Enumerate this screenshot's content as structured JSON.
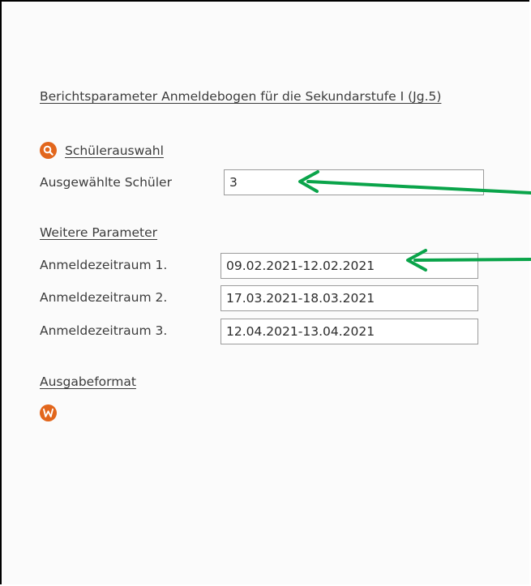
{
  "report": {
    "title": "Berichtsparameter Anmeldebogen für die Sekundarstufe I (Jg.5)"
  },
  "student_selection": {
    "link_label": "Schülerauswahl",
    "selected_label": "Ausgewählte Schüler",
    "selected_value": "3"
  },
  "further_parameters": {
    "heading": "Weitere Parameter",
    "periods": [
      {
        "label": "Anmeldezeitraum 1.",
        "value": "09.02.2021-12.02.2021"
      },
      {
        "label": "Anmeldezeitraum 2.",
        "value": "17.03.2021-18.03.2021"
      },
      {
        "label": "Anmeldezeitraum 3.",
        "value": "12.04.2021-13.04.2021"
      }
    ]
  },
  "output": {
    "heading": "Ausgabeformat",
    "word_icon": "word-icon"
  },
  "icons": {
    "search": "search-icon"
  },
  "colors": {
    "accent_orange": "#e2661c",
    "annotation_green": "#0aa44a"
  }
}
